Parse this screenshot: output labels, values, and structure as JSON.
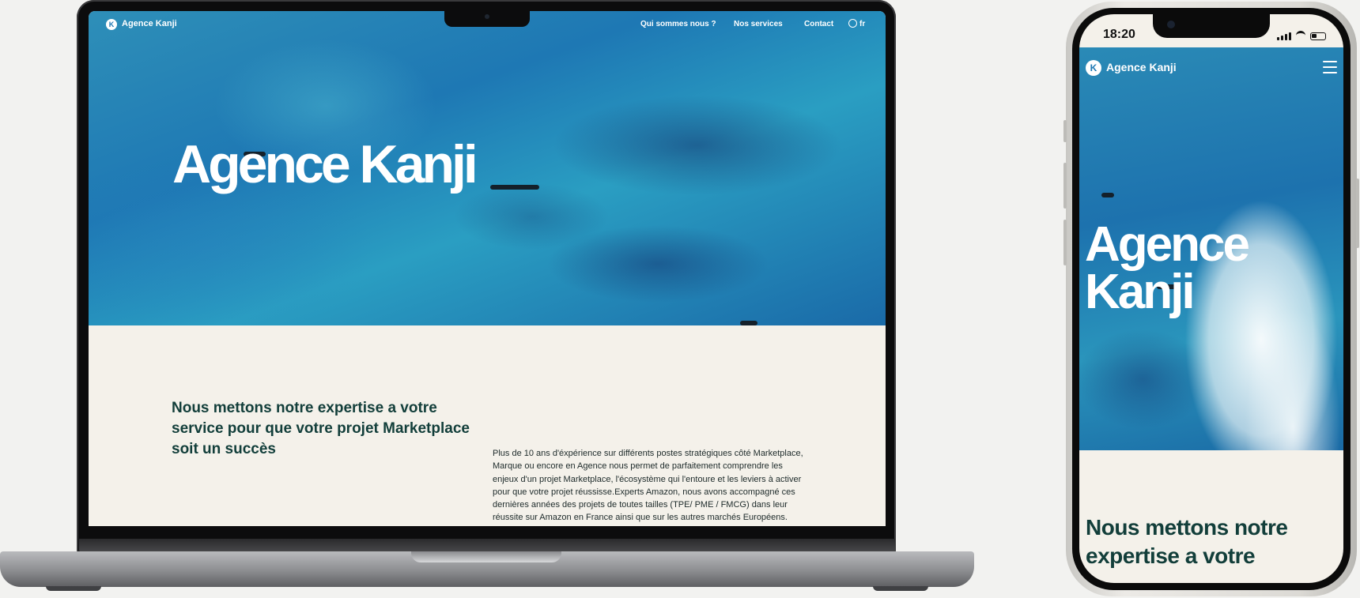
{
  "desktop": {
    "nav": {
      "logo_text": "Agence Kanji",
      "links": [
        "Qui sommes nous ?",
        "Nos services",
        "Contact"
      ],
      "language": "fr"
    },
    "hero_title": "Agence Kanji",
    "headline": "Nous mettons notre expertise a votre service pour que votre projet Marketplace soit un succès",
    "body": "Plus de 10 ans d'éxpérience sur différents postes stratégiques côté Marketplace, Marque ou encore en Agence nous permet de parfaitement comprendre les enjeux d'un projet Marketplace, l'écosystème qui l'entoure et les leviers à activer pour que votre projet réussisse.Experts Amazon, nous avons accompagné ces dernières années des projets de toutes tailles (TPE/ PME / FMCG) dans leur réussite sur Amazon en France ainsi que sur les autres marchés Européens."
  },
  "mobile": {
    "status_time": "18:20",
    "logo_text": "Agence Kanji",
    "hero_title": "Agence Kanji",
    "headline": "Nous mettons notre expertise a votre"
  },
  "colors": {
    "ocean": "#1e78b4",
    "cream": "#f4f1ea",
    "heading_green": "#123e3a"
  },
  "icons": {
    "logo": "kanji-logo-icon",
    "globe": "globe-icon",
    "menu": "hamburger-menu-icon"
  }
}
